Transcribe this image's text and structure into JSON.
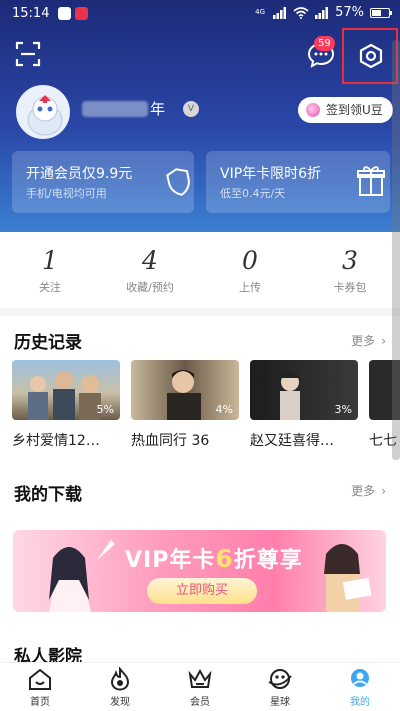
{
  "status_bar": {
    "time": "15:14",
    "network_label": "4G",
    "battery_percent": "57%",
    "battery_level": 0.57
  },
  "header": {
    "message_badge": "59",
    "username_visible": "年",
    "rank_badge": "V",
    "checkin_label": "签到领U豆"
  },
  "promos": [
    {
      "title": "开通会员仅9.9元",
      "subtitle": "手机/电视均可用"
    },
    {
      "title": "VIP年卡限时6折",
      "subtitle": "低至0.4元/天"
    }
  ],
  "stats": [
    {
      "value": "1",
      "label": "关注"
    },
    {
      "value": "4",
      "label": "收藏/预约"
    },
    {
      "value": "0",
      "label": "上传"
    },
    {
      "value": "3",
      "label": "卡券包"
    }
  ],
  "history": {
    "title": "历史记录",
    "more_label": "更多",
    "items": [
      {
        "title": "乡村爱情12…",
        "progress": "5%"
      },
      {
        "title": "热血同行 36",
        "progress": "4%"
      },
      {
        "title": "赵又廷喜得…",
        "progress": "3%"
      },
      {
        "title": "七七",
        "progress": ""
      }
    ]
  },
  "downloads": {
    "title": "我的下载",
    "more_label": "更多"
  },
  "banner": {
    "title_prefix": "VIP年卡",
    "title_highlight": "6",
    "title_suffix": "折尊享",
    "button_label": "立即购买"
  },
  "next_section_title": "私人影院",
  "tabs": [
    {
      "label": "首页"
    },
    {
      "label": "发现"
    },
    {
      "label": "会员"
    },
    {
      "label": "星球"
    },
    {
      "label": "我的"
    }
  ],
  "colors": {
    "header_top": "#1d2a78",
    "header_bottom": "#3a7fd2",
    "highlight_box": "#e8303a",
    "badge": "#ff3b5c"
  }
}
